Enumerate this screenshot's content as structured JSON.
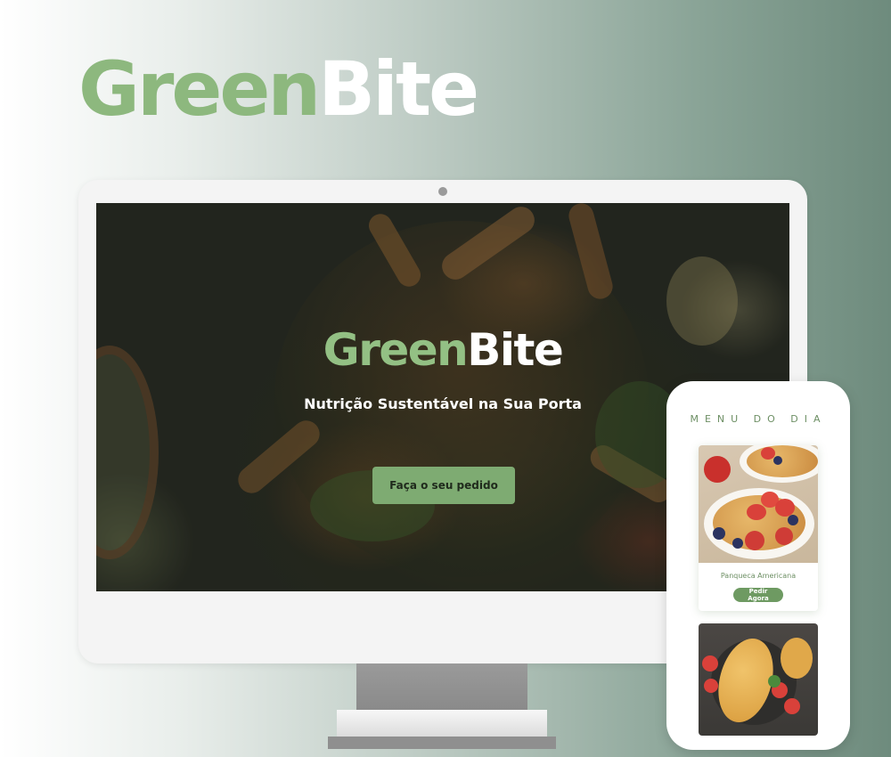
{
  "brand": {
    "green_part": "Green",
    "white_part": "Bite"
  },
  "desktop": {
    "hero": {
      "title_green": "Green",
      "title_white": "Bite",
      "subtitle": "Nutrição Sustentável na Sua Porta",
      "cta_label": "Faça o seu pedido"
    }
  },
  "mobile": {
    "menu_title": "MENU DO DIA",
    "items": [
      {
        "name": "Panqueca Americana",
        "button_label": "Pedir Agora"
      }
    ]
  },
  "colors": {
    "brand_green": "#8db87e",
    "button_green": "#7eab72",
    "mobile_button_green": "#6e9a62",
    "menu_text_green": "#6d8f64"
  }
}
